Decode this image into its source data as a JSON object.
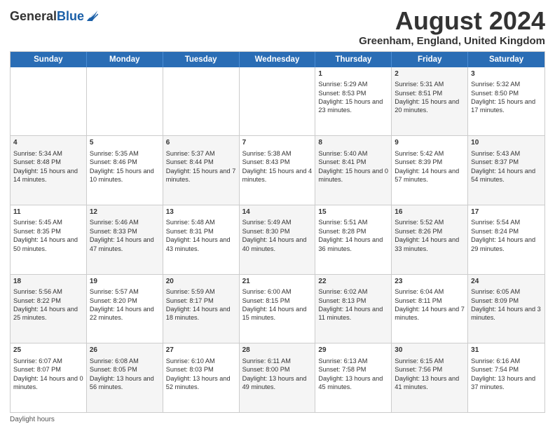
{
  "header": {
    "logo_general": "General",
    "logo_blue": "Blue",
    "month_title": "August 2024",
    "location": "Greenham, England, United Kingdom"
  },
  "calendar": {
    "days_of_week": [
      "Sunday",
      "Monday",
      "Tuesday",
      "Wednesday",
      "Thursday",
      "Friday",
      "Saturday"
    ],
    "weeks": [
      [
        {
          "day": "",
          "info": "",
          "alt": false,
          "empty": true
        },
        {
          "day": "",
          "info": "",
          "alt": false,
          "empty": true
        },
        {
          "day": "",
          "info": "",
          "alt": false,
          "empty": true
        },
        {
          "day": "",
          "info": "",
          "alt": false,
          "empty": true
        },
        {
          "day": "1",
          "info": "Sunrise: 5:29 AM\nSunset: 8:53 PM\nDaylight: 15 hours and 23 minutes.",
          "alt": false
        },
        {
          "day": "2",
          "info": "Sunrise: 5:31 AM\nSunset: 8:51 PM\nDaylight: 15 hours and 20 minutes.",
          "alt": true
        },
        {
          "day": "3",
          "info": "Sunrise: 5:32 AM\nSunset: 8:50 PM\nDaylight: 15 hours and 17 minutes.",
          "alt": false
        }
      ],
      [
        {
          "day": "4",
          "info": "Sunrise: 5:34 AM\nSunset: 8:48 PM\nDaylight: 15 hours and 14 minutes.",
          "alt": true
        },
        {
          "day": "5",
          "info": "Sunrise: 5:35 AM\nSunset: 8:46 PM\nDaylight: 15 hours and 10 minutes.",
          "alt": false
        },
        {
          "day": "6",
          "info": "Sunrise: 5:37 AM\nSunset: 8:44 PM\nDaylight: 15 hours and 7 minutes.",
          "alt": true
        },
        {
          "day": "7",
          "info": "Sunrise: 5:38 AM\nSunset: 8:43 PM\nDaylight: 15 hours and 4 minutes.",
          "alt": false
        },
        {
          "day": "8",
          "info": "Sunrise: 5:40 AM\nSunset: 8:41 PM\nDaylight: 15 hours and 0 minutes.",
          "alt": true
        },
        {
          "day": "9",
          "info": "Sunrise: 5:42 AM\nSunset: 8:39 PM\nDaylight: 14 hours and 57 minutes.",
          "alt": false
        },
        {
          "day": "10",
          "info": "Sunrise: 5:43 AM\nSunset: 8:37 PM\nDaylight: 14 hours and 54 minutes.",
          "alt": true
        }
      ],
      [
        {
          "day": "11",
          "info": "Sunrise: 5:45 AM\nSunset: 8:35 PM\nDaylight: 14 hours and 50 minutes.",
          "alt": false
        },
        {
          "day": "12",
          "info": "Sunrise: 5:46 AM\nSunset: 8:33 PM\nDaylight: 14 hours and 47 minutes.",
          "alt": true
        },
        {
          "day": "13",
          "info": "Sunrise: 5:48 AM\nSunset: 8:31 PM\nDaylight: 14 hours and 43 minutes.",
          "alt": false
        },
        {
          "day": "14",
          "info": "Sunrise: 5:49 AM\nSunset: 8:30 PM\nDaylight: 14 hours and 40 minutes.",
          "alt": true
        },
        {
          "day": "15",
          "info": "Sunrise: 5:51 AM\nSunset: 8:28 PM\nDaylight: 14 hours and 36 minutes.",
          "alt": false
        },
        {
          "day": "16",
          "info": "Sunrise: 5:52 AM\nSunset: 8:26 PM\nDaylight: 14 hours and 33 minutes.",
          "alt": true
        },
        {
          "day": "17",
          "info": "Sunrise: 5:54 AM\nSunset: 8:24 PM\nDaylight: 14 hours and 29 minutes.",
          "alt": false
        }
      ],
      [
        {
          "day": "18",
          "info": "Sunrise: 5:56 AM\nSunset: 8:22 PM\nDaylight: 14 hours and 25 minutes.",
          "alt": true
        },
        {
          "day": "19",
          "info": "Sunrise: 5:57 AM\nSunset: 8:20 PM\nDaylight: 14 hours and 22 minutes.",
          "alt": false
        },
        {
          "day": "20",
          "info": "Sunrise: 5:59 AM\nSunset: 8:17 PM\nDaylight: 14 hours and 18 minutes.",
          "alt": true
        },
        {
          "day": "21",
          "info": "Sunrise: 6:00 AM\nSunset: 8:15 PM\nDaylight: 14 hours and 15 minutes.",
          "alt": false
        },
        {
          "day": "22",
          "info": "Sunrise: 6:02 AM\nSunset: 8:13 PM\nDaylight: 14 hours and 11 minutes.",
          "alt": true
        },
        {
          "day": "23",
          "info": "Sunrise: 6:04 AM\nSunset: 8:11 PM\nDaylight: 14 hours and 7 minutes.",
          "alt": false
        },
        {
          "day": "24",
          "info": "Sunrise: 6:05 AM\nSunset: 8:09 PM\nDaylight: 14 hours and 3 minutes.",
          "alt": true
        }
      ],
      [
        {
          "day": "25",
          "info": "Sunrise: 6:07 AM\nSunset: 8:07 PM\nDaylight: 14 hours and 0 minutes.",
          "alt": false
        },
        {
          "day": "26",
          "info": "Sunrise: 6:08 AM\nSunset: 8:05 PM\nDaylight: 13 hours and 56 minutes.",
          "alt": true
        },
        {
          "day": "27",
          "info": "Sunrise: 6:10 AM\nSunset: 8:03 PM\nDaylight: 13 hours and 52 minutes.",
          "alt": false
        },
        {
          "day": "28",
          "info": "Sunrise: 6:11 AM\nSunset: 8:00 PM\nDaylight: 13 hours and 49 minutes.",
          "alt": true
        },
        {
          "day": "29",
          "info": "Sunrise: 6:13 AM\nSunset: 7:58 PM\nDaylight: 13 hours and 45 minutes.",
          "alt": false
        },
        {
          "day": "30",
          "info": "Sunrise: 6:15 AM\nSunset: 7:56 PM\nDaylight: 13 hours and 41 minutes.",
          "alt": true
        },
        {
          "day": "31",
          "info": "Sunrise: 6:16 AM\nSunset: 7:54 PM\nDaylight: 13 hours and 37 minutes.",
          "alt": false
        }
      ]
    ]
  },
  "footer": {
    "note": "Daylight hours"
  }
}
